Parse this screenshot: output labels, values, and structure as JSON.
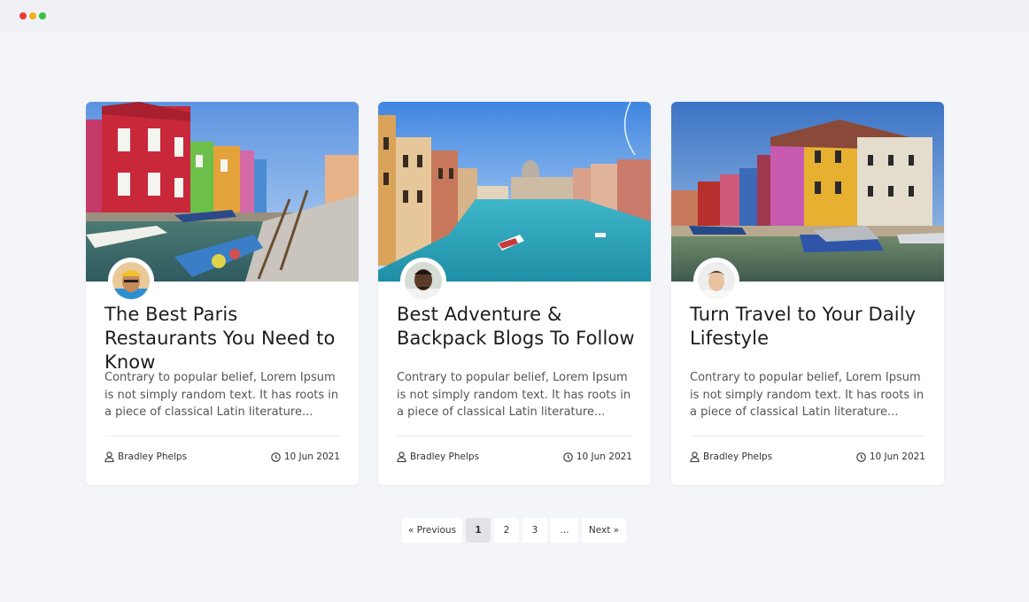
{
  "posts": [
    {
      "title": "The Best Paris Restaurants You Need to Know",
      "excerpt": "Contrary to popular belief, Lorem Ipsum is not simply random text. It has roots in a piece of classical Latin literature...",
      "author": "Bradley Phelps",
      "date": "10 Jun 2021"
    },
    {
      "title": "Best Adventure & Backpack Blogs To Follow",
      "excerpt": "Contrary to popular belief, Lorem Ipsum is not simply random text. It has roots in a piece of classical Latin literature...",
      "author": "Bradley Phelps",
      "date": "10 Jun 2021"
    },
    {
      "title": "Turn Travel to Your Daily Lifestyle",
      "excerpt": "Contrary to popular belief, Lorem Ipsum is not simply random text. It has roots in a piece of classical Latin literature...",
      "author": "Bradley Phelps",
      "date": "10 Jun 2021"
    }
  ],
  "pagination": {
    "previous_label": "« Previous",
    "pages": [
      "1",
      "2",
      "3"
    ],
    "ellipsis": "...",
    "next_label": "Next »",
    "current_page": "1"
  },
  "icons": {
    "author": "user-icon",
    "date": "clock-icon"
  },
  "colors": {
    "background": "#f4f5f9",
    "card": "#ffffff",
    "active_page": "#e2e3e7",
    "window_red": "#ee3b36",
    "window_yellow": "#f2b01d",
    "window_green": "#34c23f"
  }
}
